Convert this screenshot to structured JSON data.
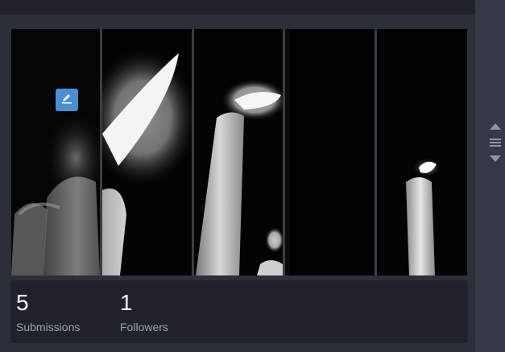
{
  "gallery": {
    "images": [
      "candle-photo-1",
      "candle-photo-2",
      "candle-photo-3",
      "candle-photo-4",
      "candle-photo-5"
    ],
    "edit_icon": "pencil-icon"
  },
  "stats": {
    "submissions": {
      "value": "5",
      "label": "Submissions"
    },
    "followers": {
      "value": "1",
      "label": "Followers"
    }
  },
  "scroll": {
    "up_icon": "arrow-up-icon",
    "menu_icon": "hamburger-icon",
    "down_icon": "arrow-down-icon"
  },
  "colors": {
    "accent": "#4a8fd4",
    "panel": "#2b2f39",
    "stats_bg": "#1f222a"
  }
}
